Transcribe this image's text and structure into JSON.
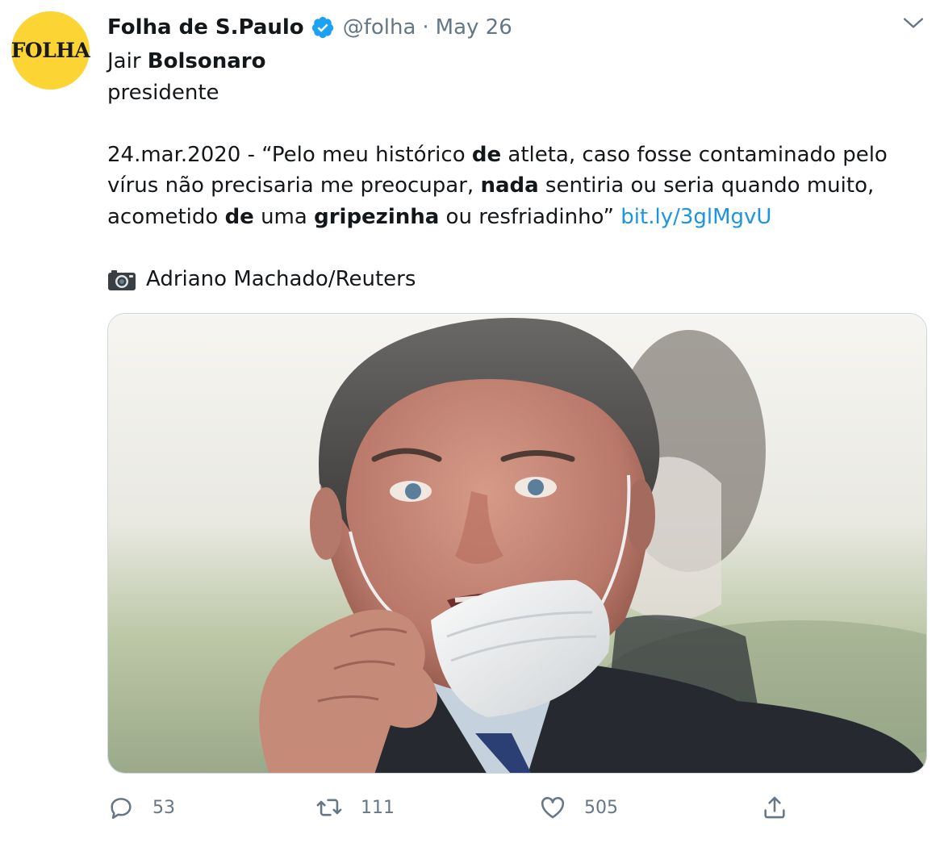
{
  "account": {
    "avatar_text": "FOLHA",
    "name": "Folha de S.Paulo",
    "handle": "@folha",
    "separator": "·",
    "date": "May 26"
  },
  "tweet": {
    "line1_pre": "Jair ",
    "line1_bold": "Bolsonaro",
    "line2": "presidente",
    "quote_part1": "24.mar.2020 - “Pelo meu histórico ",
    "quote_bold1": "de",
    "quote_part2": " atleta, caso fosse contaminado pelo vírus não precisaria me preocupar, ",
    "quote_bold2": "nada",
    "quote_part3": " sentiria ou seria quando muito, acometido ",
    "quote_bold3": "de",
    "quote_part4": " uma ",
    "quote_bold4": "gripezinha",
    "quote_part5": " ou resfriadinho” ",
    "link": "bit.ly/3glMgvU",
    "photo_credit": "Adriano Machado/Reuters"
  },
  "media": {
    "description_icon": "photo-of-man-lowering-face-mask"
  },
  "actions": {
    "replies": "53",
    "retweets": "111",
    "likes": "505"
  },
  "colors": {
    "link": "#1b95e0",
    "secondary_text": "#657786",
    "verified": "#1da1f2",
    "avatar_bg": "#fcd535"
  },
  "icons": {
    "reply": "reply-icon",
    "retweet": "retweet-icon",
    "like": "heart-icon",
    "share": "share-icon",
    "camera": "camera-icon",
    "verified": "verified-badge-icon",
    "menu": "chevron-down-icon"
  }
}
